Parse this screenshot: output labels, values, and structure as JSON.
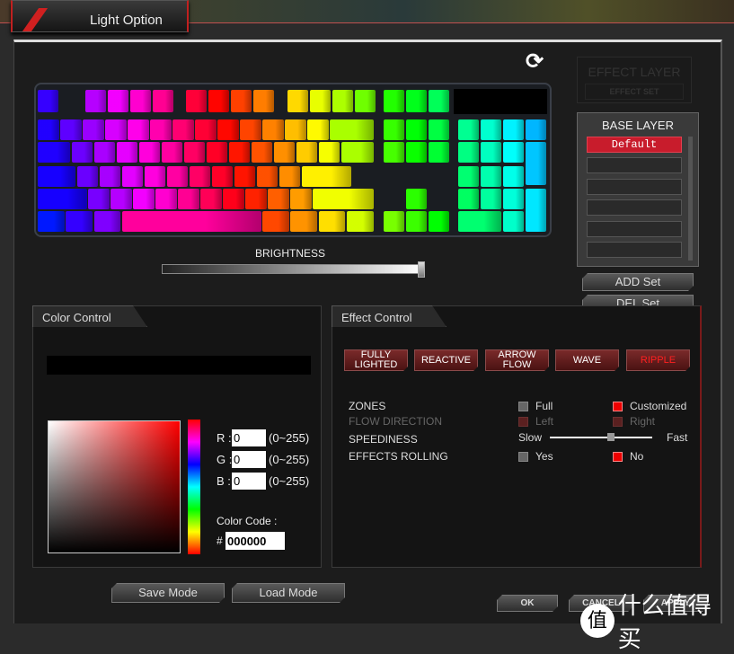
{
  "window": {
    "tab_title": "Light Option"
  },
  "keyboard": {
    "layout": "full-size 104 key",
    "lighting": "rainbow spectrum, blue left to red center to green/cyan right"
  },
  "icons": {
    "refresh": "refresh-icon"
  },
  "effect_layer": {
    "title": "EFFECT LAYER",
    "set_label": "EFFECT SET"
  },
  "base_layer": {
    "title": "BASE LAYER",
    "selected": "Default",
    "empty_slots": 5
  },
  "set_buttons": {
    "add": "ADD Set",
    "del": "DEL Set"
  },
  "brightness": {
    "label": "BRIGHTNESS",
    "value_percent": 100
  },
  "color_control": {
    "title": "Color Control",
    "r_label": "R :",
    "g_label": "G :",
    "b_label": "B :",
    "r": "0",
    "g": "0",
    "b": "0",
    "range": "(0~255)",
    "code_label": "Color Code :",
    "hash": "#",
    "code": "000000",
    "selected_hue_color": "#ff0000"
  },
  "effect_control": {
    "title": "Effect Control",
    "modes": [
      {
        "label": "FULLY LIGHTED"
      },
      {
        "label": "REACTIVE"
      },
      {
        "label": "ARROW FLOW"
      },
      {
        "label": "WAVE"
      },
      {
        "label": "RIPPLE",
        "active": true
      }
    ],
    "zones": {
      "label": "ZONES",
      "options": [
        "Full",
        "Customized"
      ],
      "selected": "Customized"
    },
    "flow": {
      "label": "FLOW DIRECTION",
      "options": [
        "Left",
        "Right"
      ],
      "disabled": true
    },
    "speed": {
      "label": "SPEEDINESS",
      "min_label": "Slow",
      "max_label": "Fast",
      "value_percent": 58
    },
    "rolling": {
      "label": "EFFECTS ROLLING",
      "options": [
        "Yes",
        "No"
      ],
      "selected": "No"
    }
  },
  "mode_buttons": {
    "save": "Save Mode",
    "load": "Load Mode"
  },
  "dialog_buttons": {
    "ok": "OK",
    "cancel": "CANCEL",
    "apply": "APPLY"
  },
  "watermark": {
    "badge": "值",
    "text": "什么值得买"
  },
  "colors": {
    "accent": "#c81c2c",
    "active_mode_text": "#ff2020"
  }
}
